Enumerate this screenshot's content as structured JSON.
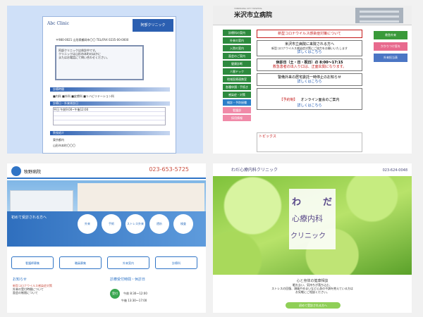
{
  "tile1": {
    "logo": "Abc Clinic",
    "header_title": "阿部クリニック",
    "address": "〒980-0021 山形県鶴岡市〇〇  TEL/FAX 0235-00-0000",
    "notice": [
      "阿部クリニックは休診中です。",
      "クリニックは山形市本町のほかに",
      "またはお電話にて問い合わせください。"
    ],
    "sections": [
      "診療時間",
      "診療日・外来休診日",
      "院長紹介"
    ],
    "rows": [
      "■内科  ■外科  ■皮膚科  ■リハビリテーション科",
      "平日 午前9:00~午後12:00",
      "東京都内",
      "山形市本町〇〇〇"
    ]
  },
  "tile2": {
    "subtitle": "YONEZAWA CITY HOSPITAL",
    "title": "米沢市立病院",
    "nav": [
      "診療科の案内",
      "外来の案内",
      "入院の案内",
      "面会のご案内",
      "健康診断",
      "人間ドック",
      "地域医療連携室",
      "各種申請・手続き",
      "感染症・対策",
      "検診・予防接種"
    ],
    "nav_pink": [
      "看護部",
      "採用情報"
    ],
    "center": {
      "banner": "新型コロナウイルス感染症対策について",
      "box1": "米沢市立病院に来院される方へ",
      "box1_sub": "新型コロナウイルス感染症対策にご協力をお願いいたします",
      "more1": "詳しくはこちら",
      "box2_title": "休診日（土・日・祝日）の 8:00～17:15",
      "box2_red": "救急患者の出入り口は、正面玄関になります。",
      "box3": "警備外来の居宅委託一時停止のお知らせ",
      "more2": "詳しくはこちら",
      "box4_red": "【予約制】",
      "box4": "オンライン面会のご案内",
      "more3": "詳しくはこちら",
      "topics": "トピックス"
    },
    "right": [
      "救急外来",
      "かかりつけ医を",
      "外来担当表"
    ]
  },
  "tile3": {
    "name": "牧野病院",
    "phone": "023-653-5725",
    "hero_caption": "初めて受診される方へ",
    "circles": [
      "外来",
      "手術",
      "ストレス外来",
      "透析",
      "検査"
    ],
    "icons": [
      "看護師募集",
      "職員募集",
      "外来案内",
      "診療科"
    ],
    "news_title": "お知らせ",
    "news": [
      "新型コロナウイルス感染症対策",
      "外来の受付時間について",
      "面会の制限について"
    ],
    "hours_title": "診療受付時間・休診日",
    "hours": [
      "午前 8:30～12:00",
      "午後 13:30～17:00"
    ],
    "g": "受付"
  },
  "tile4": {
    "name": "わだ心療内科クリニック",
    "phone": "023-624-0048",
    "card": {
      "a": "わ",
      "b": "だ",
      "mid": "心療内科",
      "sm": "クリニック"
    },
    "text": [
      "心と身体の健康相談",
      "眠れない、気持ちが落ち込む、",
      "ストレスの回復、頭痛やめまいなど心身の不調を抱えている方は",
      "お気軽にご相談ください。"
    ],
    "button": "初めて受診される方へ"
  }
}
